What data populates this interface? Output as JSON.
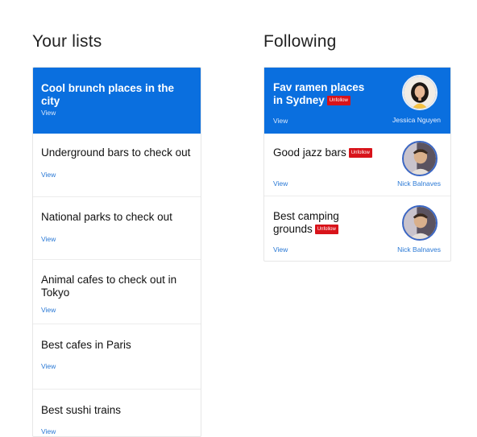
{
  "your_lists": {
    "title": "Your lists",
    "items": [
      {
        "title": "Cool brunch places in the city",
        "view": "View"
      },
      {
        "title": "Underground bars to check out",
        "view": "View"
      },
      {
        "title": "National parks to check out",
        "view": "View"
      },
      {
        "title": "Animal cafes to check out in Tokyo",
        "view": "View"
      },
      {
        "title": "Best cafes in Paris",
        "view": "View"
      },
      {
        "title": "Best sushi trains",
        "view": "View"
      }
    ]
  },
  "following": {
    "title": "Following",
    "items": [
      {
        "title": "Fav ramen places in Sydney",
        "unfollow": "Unfollow",
        "view": "View",
        "owner": "Jessica Nguyen",
        "avatar": "woman-portrait-avatar"
      },
      {
        "title": "Good jazz bars",
        "unfollow": "Unfollow",
        "view": "View",
        "owner": "Nick Balnaves",
        "avatar": "man-portrait-avatar"
      },
      {
        "title": "Best camping grounds",
        "unfollow": "Unfollow",
        "view": "View",
        "owner": "Nick Balnaves",
        "avatar": "man-portrait-avatar"
      }
    ]
  },
  "colors": {
    "accent": "#0a6fdf",
    "link": "#2a79d5",
    "unfollow": "#d8131a"
  }
}
